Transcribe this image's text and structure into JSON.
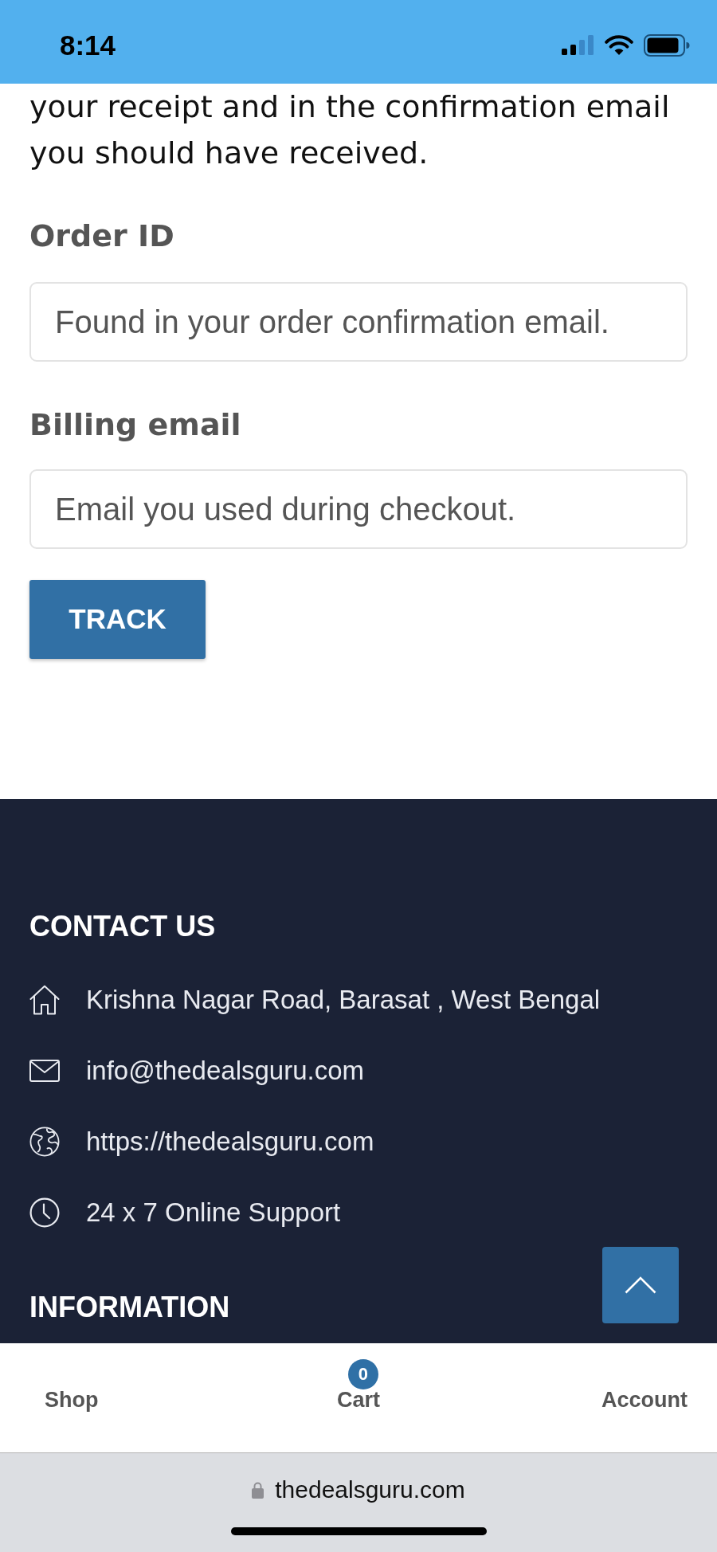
{
  "status_bar": {
    "time": "8:14"
  },
  "intro_text": "your receipt and in the confirmation email you should have received.",
  "form": {
    "fields": [
      {
        "label": "Order ID",
        "placeholder": "Found in your order confirmation email."
      },
      {
        "label": "Billing email",
        "placeholder": "Email you used during checkout."
      }
    ],
    "submit_button": "TRACK"
  },
  "footer": {
    "sections": [
      {
        "heading": "CONTACT US",
        "items": [
          {
            "kind": "address",
            "text": "Krishna Nagar Road, Barasat , West Bengal"
          },
          {
            "kind": "email",
            "text": "info@thedealsguru.com"
          },
          {
            "kind": "website",
            "text": "https://thedealsguru.com"
          },
          {
            "kind": "hours",
            "text": "24 x 7 Online Support"
          }
        ]
      },
      {
        "heading": "INFORMATION"
      }
    ]
  },
  "bottom_nav": {
    "items": [
      {
        "label": "Shop"
      },
      {
        "label": "Cart",
        "badge": "0"
      },
      {
        "label": "Account"
      }
    ]
  },
  "browser_bar": {
    "url": "thedealsguru.com"
  }
}
